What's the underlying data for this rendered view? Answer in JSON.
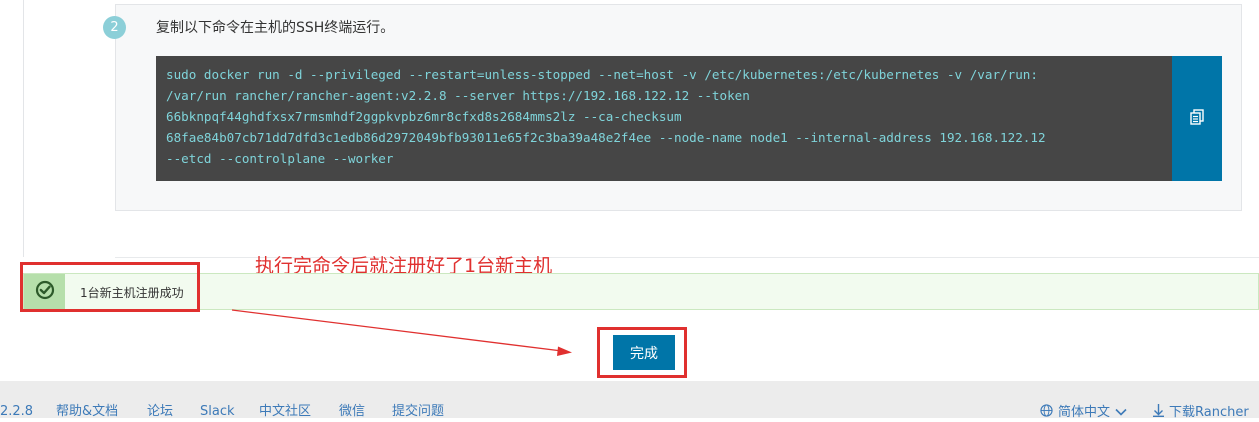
{
  "step": {
    "number": "2",
    "instruction": "复制以下命令在主机的SSH终端运行。",
    "command_lines": [
      "sudo docker run -d --privileged --restart=unless-stopped --net=host -v /etc/kubernetes:/etc/kubernetes -v /var/run:",
      "/var/run rancher/rancher-agent:v2.2.8 --server https://192.168.122.12 --token",
      "66bknpqf44ghdfxsx7rmsmhdf2ggpkvpbz6mr8cfxd8s2684mms2lz --ca-checksum",
      "68fae84b07cb71dd7dfd3c1edb86d2972049bfb93011e65f2c3ba39a48e2f4ee --node-name node1 --internal-address 192.168.122.12",
      "--etcd --controlplane --worker"
    ],
    "copy_icon": "clipboard-icon"
  },
  "annotation": {
    "text": "执行完命令后就注册好了1台新主机",
    "color": "#e0302f"
  },
  "success_banner": {
    "icon": "check-circle-icon",
    "text": "1台新主机注册成功"
  },
  "done_button": {
    "label": "完成"
  },
  "footer": {
    "version": "2.2.8",
    "links": [
      "帮助&文档",
      "论坛",
      "Slack",
      "中文社区",
      "微信",
      "提交问题"
    ],
    "language": "简体中文",
    "download": "下载Rancher"
  },
  "colors": {
    "accent": "#0075a8",
    "command_bg": "#464646",
    "command_text": "#7fd4da",
    "success_bg": "#f2fbef"
  }
}
